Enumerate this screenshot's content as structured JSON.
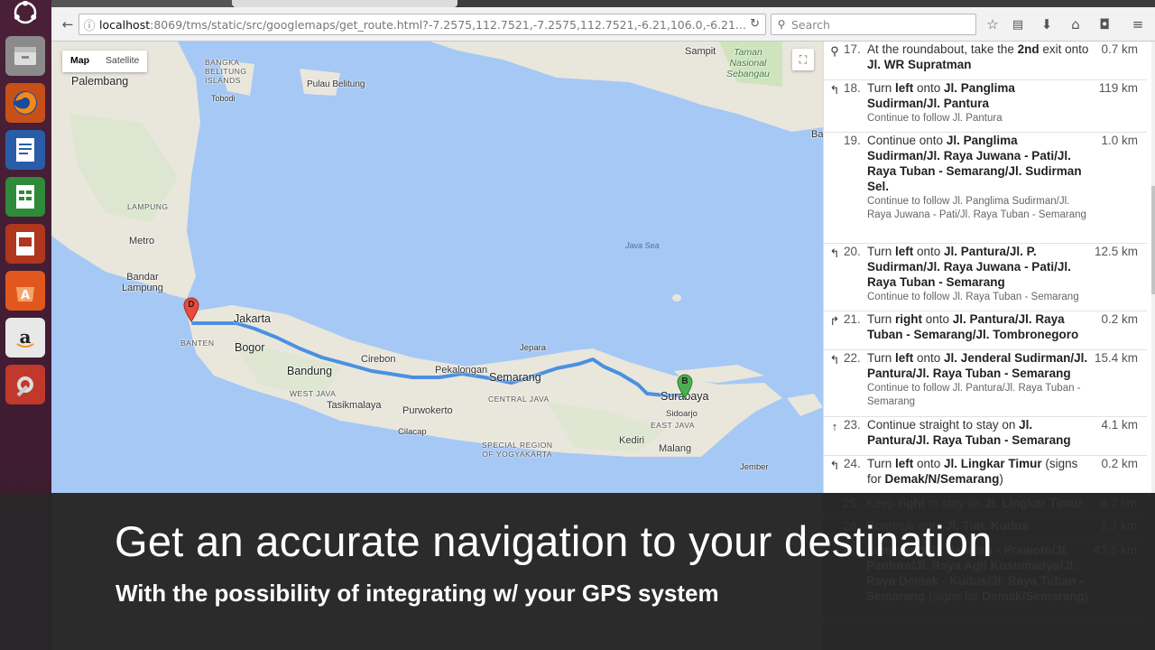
{
  "browser": {
    "url_host": "localhost",
    "url_path": ":8069/tms/static/src/googlemaps/get_route.html?-7.2575,112.7521,-7.2575,112.7521,-6.21,106.0,-6.21...",
    "search_placeholder": "Search"
  },
  "map": {
    "toggle": {
      "map_label": "Map",
      "satellite_label": "Satellite"
    },
    "places": [
      {
        "name": "Palembang",
        "kind": "big"
      },
      {
        "name": "BANGKA\nBELITUNG\nISLANDS",
        "kind": "region"
      },
      {
        "name": "Pulau Belitung",
        "kind": "normal"
      },
      {
        "name": "Tobodi",
        "kind": "small"
      },
      {
        "name": "LAMPUNG",
        "kind": "region"
      },
      {
        "name": "Metro",
        "kind": "normal"
      },
      {
        "name": "Bandar\nLampung",
        "kind": "normal"
      },
      {
        "name": "Jakarta",
        "kind": "big"
      },
      {
        "name": "BANTEN",
        "kind": "region"
      },
      {
        "name": "Bogor",
        "kind": "big"
      },
      {
        "name": "Bandung",
        "kind": "big"
      },
      {
        "name": "WEST JAVA",
        "kind": "region"
      },
      {
        "name": "Tasikmalaya",
        "kind": "normal"
      },
      {
        "name": "Cirebon",
        "kind": "normal"
      },
      {
        "name": "Pekalongan",
        "kind": "normal"
      },
      {
        "name": "Semarang",
        "kind": "big"
      },
      {
        "name": "CENTRAL JAVA",
        "kind": "region"
      },
      {
        "name": "Purwokerto",
        "kind": "normal"
      },
      {
        "name": "Cilacap",
        "kind": "small"
      },
      {
        "name": "SPECIAL REGION\nOF YOGYAKARTA",
        "kind": "region"
      },
      {
        "name": "Jepara",
        "kind": "small"
      },
      {
        "name": "Surabaya",
        "kind": "big"
      },
      {
        "name": "Sidoarjo",
        "kind": "small"
      },
      {
        "name": "EAST JAVA",
        "kind": "region"
      },
      {
        "name": "Kediri",
        "kind": "normal"
      },
      {
        "name": "Malang",
        "kind": "normal"
      },
      {
        "name": "Jember",
        "kind": "small"
      },
      {
        "name": "Java Sea",
        "kind": "sea"
      },
      {
        "name": "Sampit",
        "kind": "normal"
      },
      {
        "name": "Taman\nNasional\nSebangau",
        "kind": "park"
      },
      {
        "name": "Bar",
        "kind": "normal"
      }
    ],
    "markers": {
      "origin": "D",
      "destination": "B"
    }
  },
  "directions": [
    {
      "icon": "roundabout",
      "num": "17.",
      "html": "At the roundabout, take the <b>2nd</b> exit onto <b>Jl. WR Supratman</b>",
      "sub": "",
      "dist": "0.7 km"
    },
    {
      "icon": "left",
      "num": "18.",
      "html": "Turn <b>left</b> onto <b>Jl. Panglima Sudirman/Jl. Pantura</b>",
      "sub": "Continue to follow Jl. Pantura",
      "dist": "119 km"
    },
    {
      "icon": "none",
      "num": "19.",
      "html": "Continue onto <b>Jl. Panglima Sudirman/Jl. Raya Juwana - Pati/Jl. Raya Tuban - Semarang/Jl. Sudirman Sel.</b>",
      "sub": "Continue to follow Jl. Panglima Sudirman/Jl. Raya Juwana - Pati/Jl. Raya Tuban - Semarang",
      "dist": "1.0 km"
    },
    {
      "icon": "left",
      "num": "20.",
      "html": "Turn <b>left</b> onto <b>Jl. Pantura/Jl. P. Sudirman/Jl. Raya Juwana - Pati/Jl. Raya Tuban - Semarang</b>",
      "sub": "Continue to follow Jl. Raya Tuban - Semarang",
      "dist": "12.5 km"
    },
    {
      "icon": "right",
      "num": "21.",
      "html": "Turn <b>right</b> onto <b>Jl. Pantura/Jl. Raya Tuban - Semarang/Jl. Tombronegoro</b>",
      "sub": "",
      "dist": "0.2 km"
    },
    {
      "icon": "left",
      "num": "22.",
      "html": "Turn <b>left</b> onto <b>Jl. Jenderal Sudirman/Jl. Pantura/Jl. Raya Tuban - Semarang</b>",
      "sub": "Continue to follow Jl. Pantura/Jl. Raya Tuban - Semarang",
      "dist": "15.4 km"
    },
    {
      "icon": "straight",
      "num": "23.",
      "html": "Continue straight to stay on <b>Jl. Pantura/Jl. Raya Tuban - Semarang</b>",
      "sub": "",
      "dist": "4.1 km"
    },
    {
      "icon": "left",
      "num": "24.",
      "html": "Turn <b>left</b> onto <b>Jl. Lingkar Timur</b> (signs for <b>Demak/N/Semarang</b>)",
      "sub": "",
      "dist": "0.2 km"
    }
  ],
  "directions_faded": [
    {
      "icon": "none",
      "num": "25.",
      "html": "Keep <b>right</b> to stay on <b>Jl. Lingkar Timur</b>",
      "sub": "",
      "dist": "8.7 km"
    },
    {
      "icon": "none",
      "num": "26.",
      "html": "Continue onto <b>Jl. Tim. Kudus</b>",
      "sub": "",
      "dist": "1.7 km"
    },
    {
      "icon": "none",
      "num": "27.",
      "html": "<b>Semarang/Jl. Babalan - Prawoto/Jl. Pantura/Jl. Raya Agil Kusumadya/Jl. Raya Demak - Kudus/Jl. Raya Tuban - Semarang</b> (signs for <b>Demak/Semarang</b>)",
      "sub": "",
      "dist": "43.5 km"
    }
  ],
  "caption": {
    "title": "Get an accurate navigation to your destination",
    "subtitle": "With the possibility of integrating w/ your GPS system"
  },
  "colors": {
    "route": "#4a90e2",
    "land": "#e9e6dc",
    "sea": "#a5c8f5",
    "launcher": "#4a2038",
    "marker_origin": "#e74c3c",
    "marker_dest": "#4caf50"
  }
}
